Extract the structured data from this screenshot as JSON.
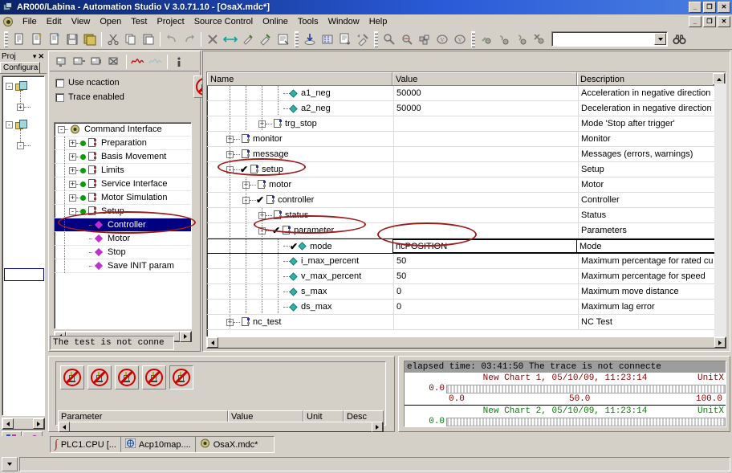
{
  "window": {
    "title": "AR000/Labina - Automation Studio V 3.0.71.10 - [OsaX.mdc*]",
    "minimize_label": "_",
    "restore_label": "❐",
    "close_label": "✕"
  },
  "menu": {
    "items": [
      "File",
      "Edit",
      "View",
      "Open",
      "Test",
      "Project",
      "Source Control",
      "Online",
      "Tools",
      "Window",
      "Help"
    ]
  },
  "toolbar": {
    "groups": [
      [
        "new-file-icon",
        "new-file-alt-icon",
        "new-file-alt2-icon",
        "save-icon",
        "save-all-icon"
      ],
      [
        "cut-icon",
        "copy-icon",
        "paste-icon"
      ],
      [
        "undo-icon",
        "redo-icon"
      ],
      [
        "delete-x-icon",
        "transfer-icon",
        "build-icon",
        "build-all-icon",
        "properties-icon"
      ],
      [
        "download-icon",
        "compile-icon",
        "listing-icon",
        "clean-icon"
      ],
      [
        "find-object-icon",
        "watch-icon",
        "modules-icon",
        "var-monitor-icon",
        "var-monitor2-icon"
      ],
      [
        "debug-run-icon",
        "debug-step-icon",
        "debug-stepinto-icon",
        "debug-stop-icon"
      ]
    ],
    "search_value": "",
    "search_button": "find-binoculars-icon"
  },
  "project_panel": {
    "title": "Proj",
    "minimize_glyph": "▾",
    "close_glyph": "✕",
    "tab_label": "Configura",
    "nodes": [
      {
        "expander": "-",
        "label": "",
        "icon": "config-folder-icon"
      },
      {
        "expander": "+",
        "label": "",
        "icon": "node-icon"
      },
      {
        "expander": "-",
        "label": "",
        "icon": "config-folder-icon"
      },
      {
        "expander": "-",
        "label": "",
        "icon": "node-icon"
      }
    ],
    "bottom_tabs": [
      "logical-view-icon",
      "physical-view-icon"
    ]
  },
  "command_panel": {
    "toolbar_icons": [
      "insert-row-icon",
      "insert-row2-icon",
      "insert-row3-icon",
      "delete-rows-icon",
      "trace-on-icon",
      "trace-off-icon",
      "info-icon"
    ],
    "checkboxes": [
      {
        "label": "Use ncaction",
        "underline": "U",
        "checked": false
      },
      {
        "label": "Trace enabled",
        "underline": "c",
        "checked": false
      }
    ],
    "action_buttons": [
      "no-entry-hand-icon",
      "no-entry-hand-icon"
    ],
    "tree": [
      {
        "label": "Command Interface",
        "depth": 0,
        "expander": "-",
        "icon": "gear-icon",
        "selected": false
      },
      {
        "label": "Preparation",
        "depth": 1,
        "expander": "+",
        "icon": "green-dot-page-icon",
        "selected": false
      },
      {
        "label": "Basis Movement",
        "depth": 1,
        "expander": "+",
        "icon": "green-dot-page-icon",
        "selected": false
      },
      {
        "label": "Limits",
        "depth": 1,
        "expander": "+",
        "icon": "green-dot-page-icon",
        "selected": false
      },
      {
        "label": "Service Interface",
        "depth": 1,
        "expander": "+",
        "icon": "green-dot-page-icon",
        "selected": false
      },
      {
        "label": "Motor Simulation",
        "depth": 1,
        "expander": "+",
        "icon": "green-dot-page-icon",
        "selected": false
      },
      {
        "label": "Setup",
        "depth": 1,
        "expander": "-",
        "icon": "green-dot-page-icon",
        "selected": false
      },
      {
        "label": "Controller",
        "depth": 2,
        "expander": "",
        "icon": "diamond-icon",
        "selected": true
      },
      {
        "label": "Motor",
        "depth": 2,
        "expander": "",
        "icon": "diamond-icon",
        "selected": false
      },
      {
        "label": "Stop",
        "depth": 2,
        "expander": "",
        "icon": "diamond-icon",
        "selected": false
      },
      {
        "label": "Save INIT param",
        "depth": 2,
        "expander": "",
        "icon": "diamond-icon",
        "selected": false
      }
    ],
    "status_text": "The test is not conne"
  },
  "grid": {
    "columns": [
      "Name",
      "Value",
      "Description"
    ],
    "rows": [
      {
        "name": "a1_neg",
        "value": "50000",
        "description": "Acceleration in negative direction",
        "indent": 5,
        "expander": "",
        "icon": "gem-icon",
        "checked": false,
        "selected": false
      },
      {
        "name": "a2_neg",
        "value": "50000",
        "description": "Deceleration in negative direction",
        "indent": 5,
        "expander": "",
        "icon": "gem-icon",
        "checked": false,
        "selected": false
      },
      {
        "name": "trg_stop",
        "value": "",
        "description": "Mode 'Stop after trigger'",
        "indent": 4,
        "expander": "+",
        "icon": "page-icon",
        "checked": false,
        "selected": false
      },
      {
        "name": "monitor",
        "value": "",
        "description": "Monitor",
        "indent": 2,
        "expander": "+",
        "icon": "page-icon",
        "checked": false,
        "selected": false
      },
      {
        "name": "message",
        "value": "",
        "description": "Messages (errors, warnings)",
        "indent": 2,
        "expander": "+",
        "icon": "page-icon",
        "checked": false,
        "selected": false
      },
      {
        "name": "setup",
        "value": "",
        "description": "Setup",
        "indent": 2,
        "expander": "-",
        "icon": "page-icon",
        "checked": true,
        "selected": false
      },
      {
        "name": "motor",
        "value": "",
        "description": "Motor",
        "indent": 3,
        "expander": "+",
        "icon": "page-icon",
        "checked": false,
        "selected": false
      },
      {
        "name": "controller",
        "value": "",
        "description": "Controller",
        "indent": 3,
        "expander": "-",
        "icon": "page-icon",
        "checked": true,
        "selected": false
      },
      {
        "name": "status",
        "value": "",
        "description": "Status",
        "indent": 4,
        "expander": "+",
        "icon": "page-icon",
        "checked": false,
        "selected": false
      },
      {
        "name": "parameter",
        "value": "",
        "description": "Parameters",
        "indent": 4,
        "expander": "-",
        "icon": "page-icon",
        "checked": true,
        "selected": false
      },
      {
        "name": "mode",
        "value": "ncPOSITION",
        "description": "Mode",
        "indent": 5,
        "expander": "",
        "icon": "gem-icon",
        "checked": true,
        "selected": true
      },
      {
        "name": "i_max_percent",
        "value": "50",
        "description": "Maximum percentage for rated cu",
        "indent": 5,
        "expander": "",
        "icon": "gem-icon",
        "checked": false,
        "selected": false
      },
      {
        "name": "v_max_percent",
        "value": "50",
        "description": "Maximum percentage for speed",
        "indent": 5,
        "expander": "",
        "icon": "gem-icon",
        "checked": false,
        "selected": false
      },
      {
        "name": "s_max",
        "value": "0",
        "description": "Maximum move distance",
        "indent": 5,
        "expander": "",
        "icon": "gem-icon",
        "checked": false,
        "selected": false
      },
      {
        "name": "ds_max",
        "value": "0",
        "description": "Maximum lag error",
        "indent": 5,
        "expander": "",
        "icon": "gem-icon",
        "checked": false,
        "selected": false
      },
      {
        "name": "nc_test",
        "value": "",
        "description": "NC Test",
        "indent": 2,
        "expander": "+",
        "icon": "page-icon",
        "checked": false,
        "selected": false
      }
    ]
  },
  "watch_panel": {
    "buttons": [
      "no-entry-hand-icon",
      "no-entry-hand-icon",
      "no-entry-hand-icon",
      "no-entry-hand-icon",
      "no-entry-hand-icon"
    ],
    "columns": [
      "Parameter",
      "Value",
      "Unit",
      "Desc"
    ]
  },
  "trace_panel": {
    "status": "elapsed time: 03:41:50  The trace is not connecte",
    "charts": [
      {
        "title": "New Chart 1, 05/10/09, 11:23:14",
        "unit": "UnitX",
        "ylabel": "0.0",
        "xticks": [
          "0.0",
          "50.0",
          "100.0"
        ],
        "color": "#8b0000"
      },
      {
        "title": "New Chart 2, 05/10/09, 11:23:14",
        "unit": "UnitX",
        "ylabel": "0.0",
        "xticks": [],
        "color": "#0a7a0a"
      }
    ]
  },
  "document_tabs": [
    {
      "label": "PLC1.CPU [...",
      "icon": "integral-icon"
    },
    {
      "label": "Acp10map....",
      "icon": "map-icon"
    },
    {
      "label": "OsaX.mdc*",
      "icon": "gear-icon"
    }
  ],
  "chart_data": {
    "type": "line",
    "title": "New Chart 1, 05/10/09, 11:23:14",
    "xlabel": "",
    "ylabel": "UnitX",
    "x": [
      0.0,
      50.0,
      100.0
    ],
    "series": [
      {
        "name": "New Chart 1",
        "values": [
          0.0,
          0.0,
          0.0
        ],
        "color": "#8b0000"
      },
      {
        "name": "New Chart 2",
        "values": [
          0.0,
          0.0,
          0.0
        ],
        "color": "#0a7a0a"
      }
    ],
    "xlim": [
      0.0,
      100.0
    ],
    "ylim": [
      0.0,
      0.0
    ],
    "grid": false,
    "legend": "none"
  },
  "colors": {
    "title_blue": "#0a246a",
    "face": "#d4d0c8",
    "selection": "#000080",
    "annotation_red": "#9e1b1b"
  }
}
